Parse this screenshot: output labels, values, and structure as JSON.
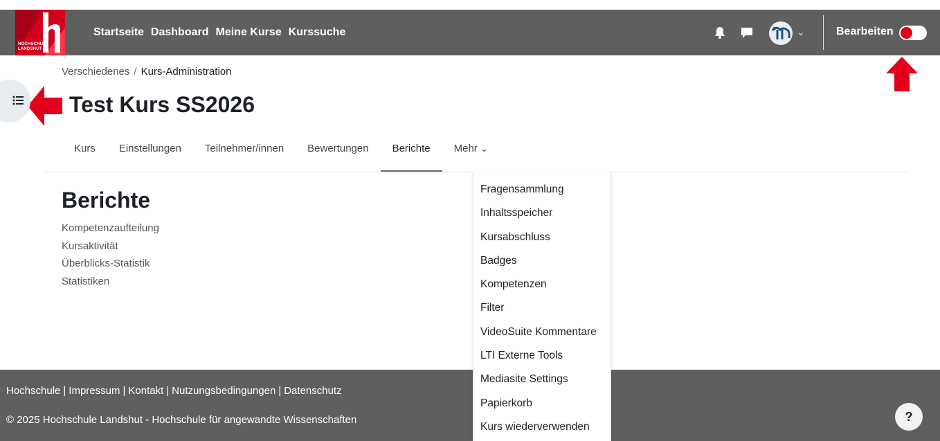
{
  "navbar": {
    "logo_text_line1": "HOCHSCHULE",
    "logo_text_line2": "LANDSHUT",
    "links": [
      "Startseite",
      "Dashboard",
      "Meine Kurse",
      "Kurssuche"
    ],
    "edit_label": "Bearbeiten",
    "edit_mode": false,
    "icons": [
      "bell-icon",
      "chat-icon",
      "avatar",
      "chevron-down-icon"
    ]
  },
  "breadcrumb": {
    "parent": "Verschiedenes",
    "separator": "/",
    "current": "Kurs-Administration"
  },
  "course": {
    "title": "Test Kurs SS2026"
  },
  "secondary_nav": {
    "tabs": [
      "Kurs",
      "Einstellungen",
      "Teilnehmer/innen",
      "Bewertungen",
      "Berichte",
      "Mehr"
    ],
    "active": "Berichte",
    "more_caret": "⌄"
  },
  "main": {
    "heading": "Berichte",
    "reports": [
      "Kompetenzaufteilung",
      "Kursaktivität",
      "Überblicks-Statistik",
      "Statistiken"
    ]
  },
  "more_menu": {
    "items": [
      "Fragensammlung",
      "Inhaltsspeicher",
      "Kursabschluss",
      "Badges",
      "Kompetenzen",
      "Filter",
      "VideoSuite Kommentare",
      "LTI Externe Tools",
      "Mediasite Settings",
      "Papierkorb",
      "Kurs wiederverwenden"
    ]
  },
  "footer": {
    "links": [
      "Hochschule",
      "Impressum",
      "Kontakt",
      "Nutzungsbedingungen",
      "Datenschutz"
    ],
    "link_separator": "|",
    "copyright": "© 2025 Hochschule Landshut - Hochschule für angewandte Wissenschaften",
    "help_label": "?"
  },
  "colors": {
    "navbar_bg": "#5f5f5f",
    "brand_red": "#d4001f",
    "annotation_arrow": "#e2001a"
  }
}
